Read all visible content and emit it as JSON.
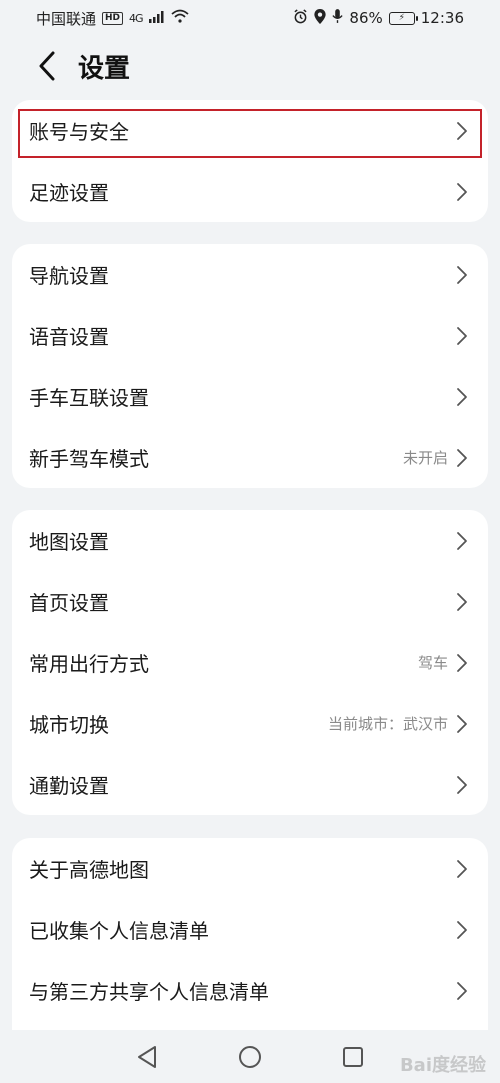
{
  "status_bar": {
    "carrier": "中国联通",
    "network": "4G",
    "hd": "HD",
    "battery": "86%",
    "time": "12:36"
  },
  "header": {
    "title": "设置"
  },
  "groups": [
    {
      "items": [
        {
          "label": "账号与安全",
          "value": ""
        },
        {
          "label": "足迹设置",
          "value": ""
        }
      ]
    },
    {
      "items": [
        {
          "label": "导航设置",
          "value": ""
        },
        {
          "label": "语音设置",
          "value": ""
        },
        {
          "label": "手车互联设置",
          "value": ""
        },
        {
          "label": "新手驾车模式",
          "value": "未开启"
        }
      ]
    },
    {
      "items": [
        {
          "label": "地图设置",
          "value": ""
        },
        {
          "label": "首页设置",
          "value": ""
        },
        {
          "label": "常用出行方式",
          "value": "驾车"
        },
        {
          "label": "城市切换",
          "value": "当前城市：武汉市"
        },
        {
          "label": "通勤设置",
          "value": ""
        }
      ]
    },
    {
      "items": [
        {
          "label": "关于高德地图",
          "value": ""
        },
        {
          "label": "已收集个人信息清单",
          "value": ""
        },
        {
          "label": "与第三方共享个人信息清单",
          "value": ""
        }
      ]
    }
  ],
  "watermark": "Bai度经验",
  "colors": {
    "background": "#f1f3f5",
    "card": "#ffffff",
    "highlight": "#c4222a",
    "secondary_text": "#8a8a8a"
  }
}
